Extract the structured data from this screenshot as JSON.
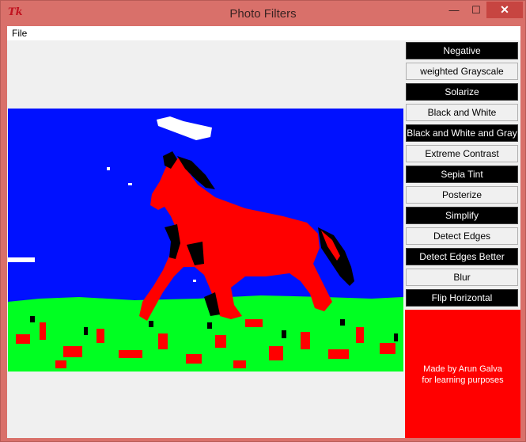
{
  "window": {
    "title": "Photo Filters",
    "icon_text": "Tk",
    "minimize_glyph": "—",
    "maximize_glyph": "☐",
    "close_glyph": "✕"
  },
  "menu": {
    "file_label": "File"
  },
  "photo": {
    "description": "posterized horse",
    "colors": {
      "sky": "#0011ff",
      "grass": "#00ff22",
      "horse": "#ff0000",
      "cloud": "#ffffff",
      "shadow": "#000000"
    }
  },
  "filters": [
    {
      "label": "Negative",
      "style": "dark"
    },
    {
      "label": "weighted Grayscale",
      "style": "light"
    },
    {
      "label": "Solarize",
      "style": "dark"
    },
    {
      "label": "Black and White",
      "style": "light"
    },
    {
      "label": "Black and White and Gray",
      "style": "dark"
    },
    {
      "label": "Extreme Contrast",
      "style": "light"
    },
    {
      "label": "Sepia Tint",
      "style": "dark"
    },
    {
      "label": "Posterize",
      "style": "light"
    },
    {
      "label": "Simplify",
      "style": "dark"
    },
    {
      "label": "Detect Edges",
      "style": "light"
    },
    {
      "label": "Detect Edges Better",
      "style": "dark"
    },
    {
      "label": "Blur",
      "style": "light"
    },
    {
      "label": "Flip Horizontal",
      "style": "dark"
    }
  ],
  "credit": {
    "line1": "Made by Arun Galva",
    "line2": "for learning purposes",
    "background": "#ff0000"
  }
}
